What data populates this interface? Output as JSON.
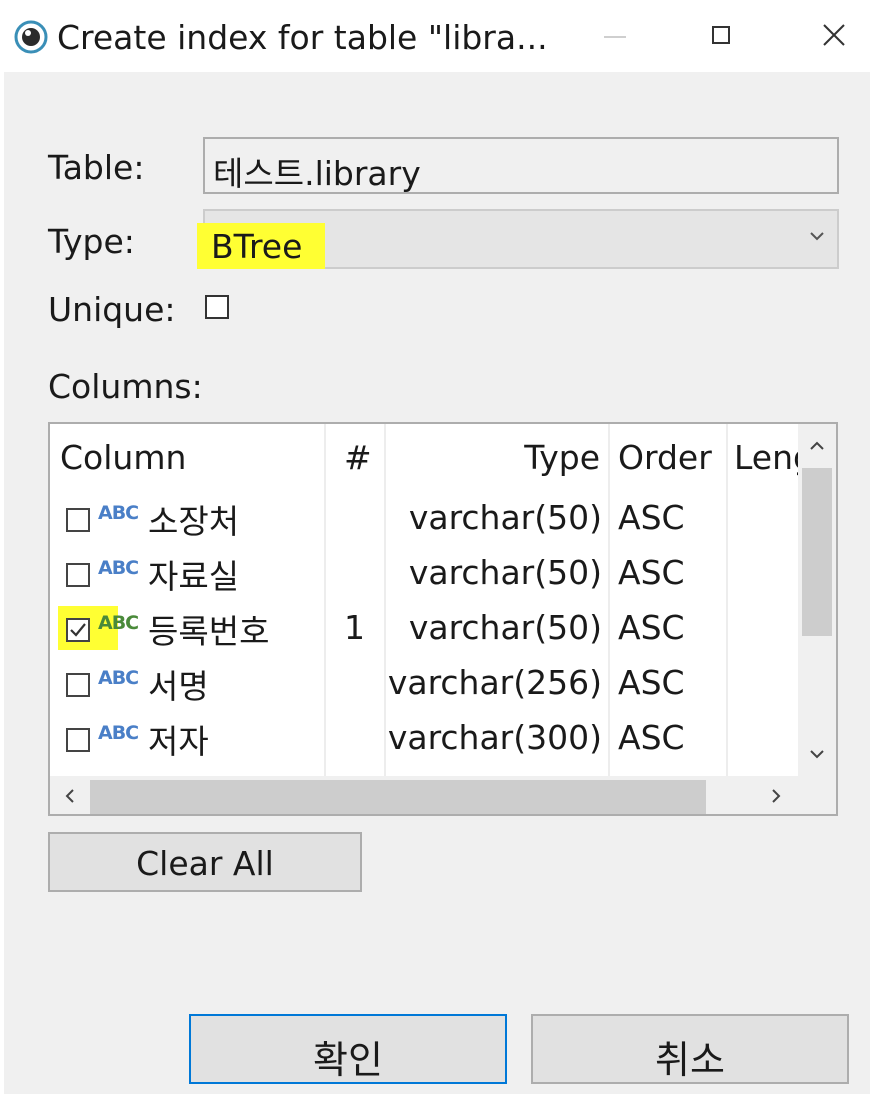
{
  "window": {
    "title": "Create index for table \"libra..."
  },
  "form": {
    "table_label": "Table:",
    "table_value": "테스트.library",
    "type_label": "Type:",
    "type_value": "BTree",
    "unique_label": "Unique:",
    "unique_checked": false,
    "columns_label": "Columns:"
  },
  "columns_table": {
    "headers": [
      "Column",
      "#",
      "Type",
      "Order",
      "Leng"
    ],
    "rows": [
      {
        "checked": false,
        "icon": "ABC",
        "name": "소장처",
        "num": "",
        "type": "varchar(50)",
        "order": "ASC"
      },
      {
        "checked": false,
        "icon": "ABC",
        "name": "자료실",
        "num": "",
        "type": "varchar(50)",
        "order": "ASC"
      },
      {
        "checked": true,
        "icon": "ABC",
        "name": "등록번호",
        "num": "1",
        "type": "varchar(50)",
        "order": "ASC"
      },
      {
        "checked": false,
        "icon": "ABC",
        "name": "서명",
        "num": "",
        "type": "varchar(256)",
        "order": "ASC"
      },
      {
        "checked": false,
        "icon": "ABC",
        "name": "저자",
        "num": "",
        "type": "varchar(300)",
        "order": "ASC"
      }
    ]
  },
  "buttons": {
    "clear_all": "Clear All",
    "ok": "확인",
    "cancel": "취소"
  },
  "colors": {
    "highlight": "#ffff33",
    "abc_icon": "#4a7fc7",
    "focus_border": "#0078d7"
  }
}
